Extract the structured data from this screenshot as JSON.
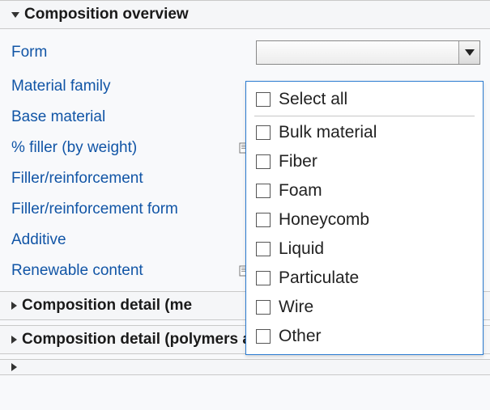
{
  "section": {
    "title": "Composition overview",
    "expanded": true,
    "rows": [
      {
        "label": "Form"
      },
      {
        "label": "Material family"
      },
      {
        "label": "Base material"
      },
      {
        "label": "% filler (by weight)",
        "has_icon": true
      },
      {
        "label": "Filler/reinforcement"
      },
      {
        "label": "Filler/reinforcement form"
      },
      {
        "label": "Additive"
      },
      {
        "label": "Renewable content",
        "has_icon": true
      }
    ]
  },
  "collapsed_sections": [
    {
      "title": "Composition detail (me"
    },
    {
      "title": "Composition detail (polymers and natural materi"
    }
  ],
  "combo": {
    "value": ""
  },
  "dropdown": {
    "select_all": "Select all",
    "options": [
      "Bulk material",
      "Fiber",
      "Foam",
      "Honeycomb",
      "Liquid",
      "Particulate",
      "Wire",
      "Other"
    ]
  }
}
